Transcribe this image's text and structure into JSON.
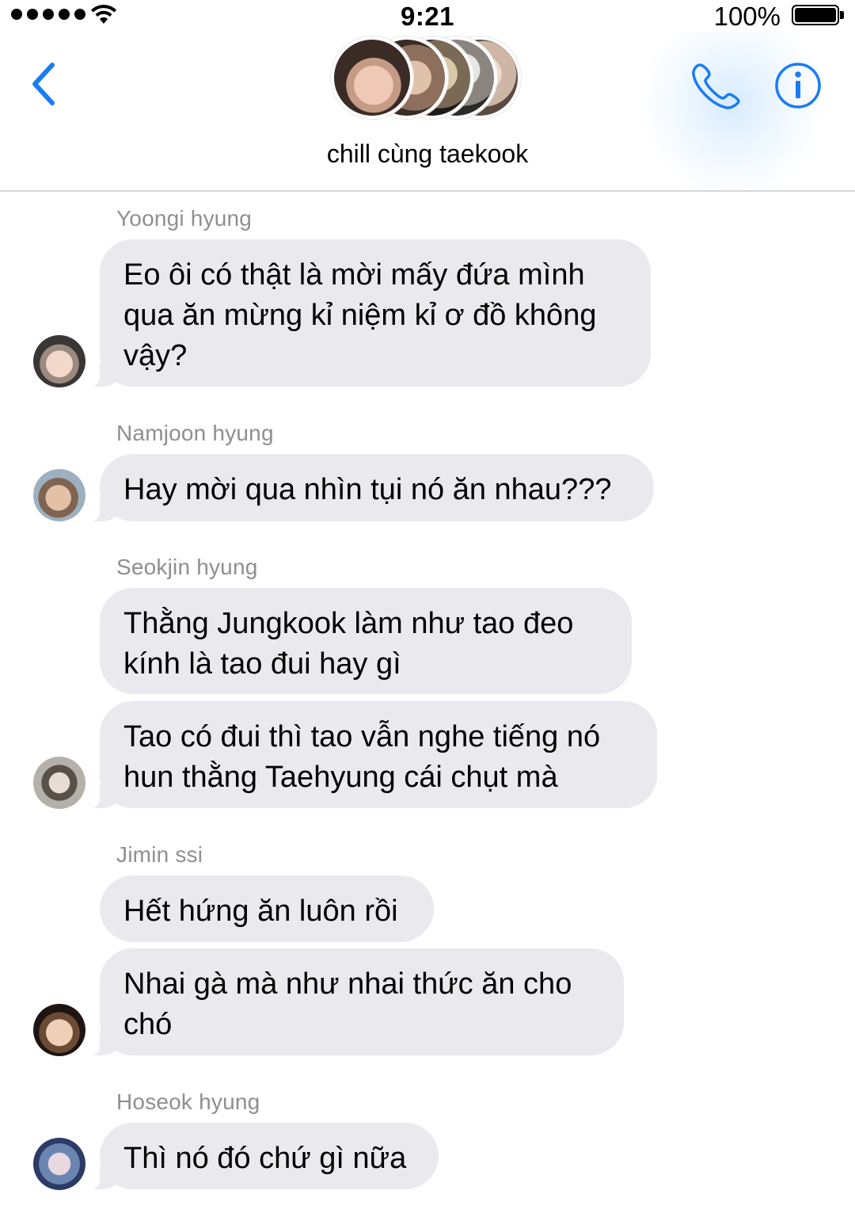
{
  "status_bar": {
    "time": "9:21",
    "battery_percent": "100%",
    "battery_level": 1.0,
    "signal_icon": "signal-dots-icon",
    "wifi_icon": "wifi-icon"
  },
  "header": {
    "title": "chill cùng taekook",
    "back_icon": "chevron-left-icon",
    "call_icon": "phone-icon",
    "info_icon": "info-icon",
    "accent_color": "#1a7cf4"
  },
  "messages": [
    {
      "sender": "Yoongi hyung",
      "bubbles": [
        "Eo ôi có thật là mời mấy đứa mình\nqua ăn mừng kỉ niệm kỉ ơ đồ không\nvậy?"
      ]
    },
    {
      "sender": "Namjoon hyung",
      "bubbles": [
        "Hay mời qua nhìn tụi nó ăn nhau???"
      ]
    },
    {
      "sender": "Seokjin hyung",
      "bubbles": [
        "Thằng Jungkook làm như tao đeo\nkính là tao đui hay gì",
        "Tao có đui thì tao vẫn nghe tiếng nó\nhun thằng Taehyung cái chụt mà"
      ]
    },
    {
      "sender": "Jimin ssi",
      "bubbles": [
        "Hết hứng ăn luôn rồi",
        "Nhai gà mà như nhai thức ăn cho\nchó"
      ]
    },
    {
      "sender": "Hoseok hyung",
      "bubbles": [
        "Thì nó đó chứ gì nữa"
      ]
    }
  ],
  "colors": {
    "bubble_bg": "#e9e9ee",
    "sender_name": "#8e8e93",
    "divider": "#d6d6d9"
  }
}
